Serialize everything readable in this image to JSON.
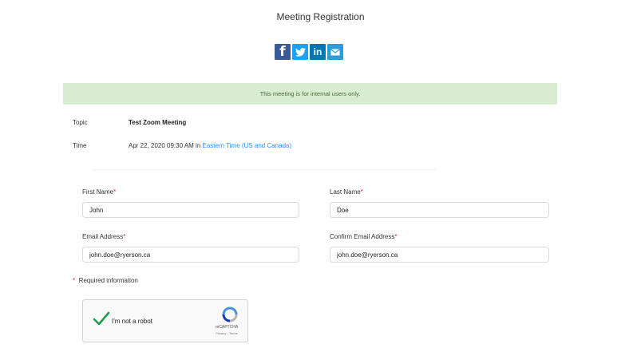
{
  "page": {
    "title": "Meeting Registration"
  },
  "share": {
    "facebook": "f",
    "twitter_icon": "twitter-bird",
    "linkedin": "in",
    "email_icon": "envelope"
  },
  "banner": {
    "text": "This meeting is for internal users only."
  },
  "meeting": {
    "topic_label": "Topic",
    "topic_value": "Test Zoom Meeting",
    "time_label": "Time",
    "time_value": "Apr 22, 2020 09:30 AM in ",
    "timezone": "Eastern Time (US and Canada)"
  },
  "form": {
    "first_name": {
      "label": "First Name",
      "value": "John"
    },
    "last_name": {
      "label": "Last Name",
      "value": "Doe"
    },
    "email": {
      "label": "Email Address",
      "value": "john.doe@ryerson.ca"
    },
    "confirm_email": {
      "label": "Confirm Email Address",
      "value": "john.doe@ryerson.ca"
    },
    "required_star": "*",
    "required_note": "Required information"
  },
  "captcha": {
    "label": "I'm not a robot",
    "brand": "reCAPTCHA",
    "terms": "Privacy - Terms"
  },
  "colors": {
    "accent": "#2d8cff",
    "banner_bg": "#d8ecd1",
    "required": "#e02828",
    "check": "#1e9e4a"
  }
}
